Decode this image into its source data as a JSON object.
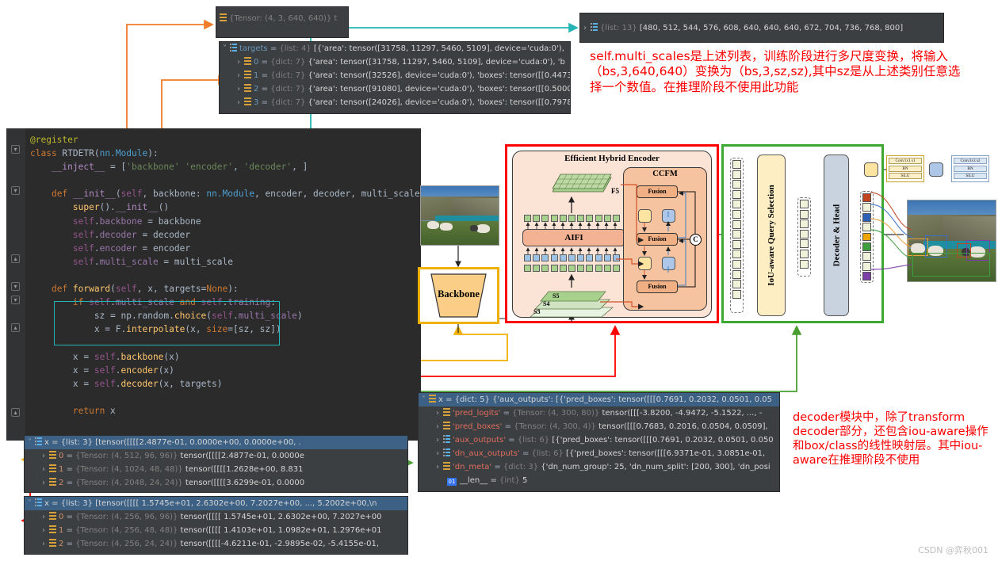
{
  "code_editor": {
    "lines": [
      "@register",
      "class RTDETR(nn.Module):",
      "    __inject__ = ['backbone' 'encoder', 'decoder', ]",
      "",
      "    def __init__(self, backbone: nn.Module, encoder, decoder, multi_scale=None):",
      "        super().__init__()",
      "        self.backbone = backbone",
      "        self.decoder = decoder",
      "        self.encoder = encoder",
      "        self.multi_scale = multi_scale",
      "",
      "    def forward(self, x, targets=None):",
      "        if self.multi_scale and self.training:",
      "            sz = np.random.choice(self.multi_scale)",
      "            x = F.interpolate(x, size=[sz, sz])",
      "",
      "        x = self.backbone(x)",
      "        x = self.encoder(x)",
      "        x = self.decoder(x, targets)",
      "",
      "        return x"
    ]
  },
  "tooltip_tensor": {
    "type": "{Tensor: (4, 3, 640, 640)}",
    "trail": "t"
  },
  "targets_panel": {
    "header": {
      "name": "targets",
      "eq": "=",
      "type": "{list: 4}",
      "value": "[{'area': tensor([31758, 11297,  5460,  5109], device='cuda:0'),"
    },
    "rows": [
      {
        "index": "0",
        "type": "{dict: 7}",
        "value": "{'area': tensor([31758, 11297,  5460,  5109], device='cuda:0'), 'b"
      },
      {
        "index": "1",
        "type": "{dict: 7}",
        "value": "{'area': tensor([32526], device='cuda:0'), 'boxes': tensor([[0.4473"
      },
      {
        "index": "2",
        "type": "{dict: 7}",
        "value": "{'area': tensor([91080], device='cuda:0'), 'boxes': tensor([[0.5000"
      },
      {
        "index": "3",
        "type": "{dict: 7}",
        "value": "{'area': tensor([24026], device='cuda:0'), 'boxes': tensor([[0.7978"
      }
    ]
  },
  "multiscale_panel": {
    "type": "{list: 13}",
    "value": "[480, 512, 544, 576, 608, 640, 640, 640, 672, 704, 736, 768, 800]"
  },
  "backbone_out_panel": {
    "header": {
      "name": "x",
      "eq": "=",
      "type": "{list: 3}",
      "value": "[tensor([[[[2.4877e-01, 0.0000e+00, 0.0000e+00,  ."
    },
    "rows": [
      {
        "index": "0",
        "type": "{Tensor: (4, 512, 96, 96)}",
        "value": "tensor([[[[2.4877e-01, 0.0000e"
      },
      {
        "index": "1",
        "type": "{Tensor: (4, 1024, 48, 48)}",
        "value": "tensor([[[[1.2628e+00, 8.831"
      },
      {
        "index": "2",
        "type": "{Tensor: (4, 2048, 24, 24)}",
        "value": "tensor([[[[3.6299e-01, 0.0000"
      }
    ]
  },
  "encoder_out_panel": {
    "header": {
      "name": "x",
      "eq": "=",
      "type": "{list: 3}",
      "value": "[tensor([[[[ 1.5745e+01,  2.6302e+00,  7.2027e+00,  ...,  5.2002e+00,\\n"
    },
    "rows": [
      {
        "index": "0",
        "type": "{Tensor: (4, 256, 96, 96)}",
        "value": "tensor([[[[ 1.5745e+01,  2.6302e+00,  7.2027e+00"
      },
      {
        "index": "1",
        "type": "{Tensor: (4, 256, 48, 48)}",
        "value": "tensor([[[[ 1.4103e+01,  1.0982e+01,  1.2976e+01"
      },
      {
        "index": "2",
        "type": "{Tensor: (4, 256, 24, 24)}",
        "value": "tensor([[[[-4.6211e-01, -2.9895e-02, -5.4155e-01,"
      }
    ]
  },
  "decoder_out_panel": {
    "header": {
      "name": "x",
      "eq": "=",
      "type": "{dict: 5}",
      "value": "{'aux_outputs': [{'pred_boxes': tensor([[[0.7691, 0.2032, 0.0501, 0.05"
    },
    "rows": [
      {
        "key": "'pred_logits'",
        "type": "{Tensor: (4, 300, 80)}",
        "value": "tensor([[[-3.8200, -4.9472, -5.1522,  ..., -"
      },
      {
        "key": "'pred_boxes'",
        "type": "{Tensor: (4, 300, 4)}",
        "value": "tensor([[[0.7683, 0.2016, 0.0504, 0.0509],"
      },
      {
        "key": "'aux_outputs'",
        "type": "{list: 6}",
        "value": "[{'pred_boxes': tensor([[[0.7691, 0.2032, 0.0501, 0.050"
      },
      {
        "key": "'dn_aux_outputs'",
        "type": "{list: 6}",
        "value": "[{'pred_boxes': tensor([[[6.9371e-01, 3.0851e-01, "
      },
      {
        "key": "'dn_meta'",
        "type": "{dict: 3}",
        "value": "{'dn_num_group': 25, 'dn_num_split': [200, 300], 'dn_posi"
      }
    ],
    "len_row": {
      "icon_label": "01",
      "name": "__len__",
      "eq": "=",
      "type": "{int}",
      "value": "5"
    }
  },
  "diagram": {
    "backbone_label": "Backbone",
    "encoder_title": "Efficient Hybrid Encoder",
    "ccfm_title": "CCFM",
    "aifi_label": "AIFI",
    "f5_label": "F5",
    "scale_labels": [
      "S5",
      "S4",
      "S3"
    ],
    "fusion_label": "Fusion",
    "concat_label": "C",
    "query_selection_label": "IoU-aware Query Selection",
    "decoder_head_label": "Decoder & Head",
    "conv_blocks": [
      {
        "name": "conv1x1",
        "lines": [
          "Conv1x1 s1",
          "BN",
          "SiLU"
        ]
      },
      {
        "name": "conv3x3",
        "lines": [
          "Conv3x3 s2",
          "BN",
          "SiLU"
        ]
      }
    ]
  },
  "annotations": {
    "multi_scale_note": "self.multi_scales是上述列表，训练阶段进行多尺度变换，将输入（bs,3,640,640）变换为（bs,3,sz,sz),其中sz是从上述类别任意选择一个数值。在推理阶段不使用此功能",
    "decoder_note": "decoder模块中，除了transform decoder部分，还包含iou-aware操作和box/class的线性映射层。其中iou-aware在推理阶段不使用"
  },
  "watermark": "CSDN @弈秋001",
  "colors": {
    "red_box": "#ff0000",
    "green_box": "#3ca832",
    "yellow_box": "#f0b000",
    "orange_arrow": "#ef7c28",
    "teal_arrow": "#23b5b5",
    "editor_bg": "#2b2b2b",
    "panel_bg": "#3c3f41",
    "selection": "#3d6185",
    "annotation_text": "#ff0000"
  }
}
